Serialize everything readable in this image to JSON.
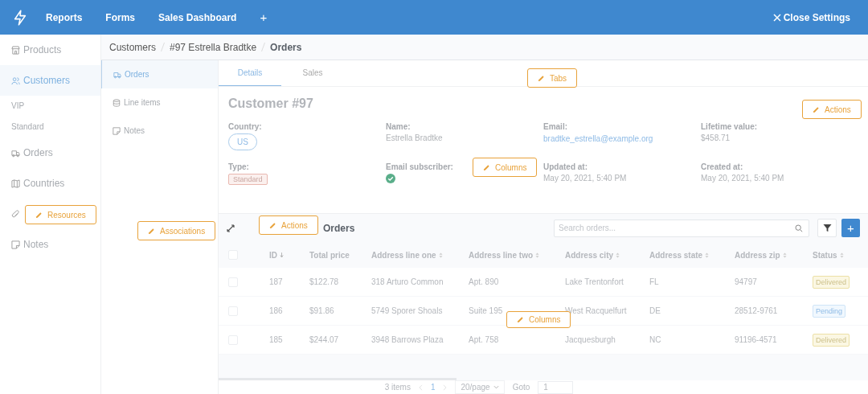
{
  "topbar": {
    "items": [
      "Reports",
      "Forms",
      "Sales Dashboard"
    ],
    "add": "+",
    "close": "Close Settings"
  },
  "sidebar": {
    "items": [
      {
        "label": "Products",
        "kind": "store",
        "selected": false
      },
      {
        "label": "Customers",
        "kind": "users",
        "selected": true,
        "children": [
          {
            "label": "VIP"
          },
          {
            "label": "Standard"
          }
        ]
      },
      {
        "label": "Orders",
        "kind": "truck",
        "selected": false
      },
      {
        "label": "Countries",
        "kind": "map",
        "selected": false
      },
      {
        "kind": "paperclip",
        "selected": false
      },
      {
        "label": "Notes",
        "kind": "note",
        "selected": false
      }
    ]
  },
  "breadcrumb": [
    "Customers",
    "#97 Estrella Bradtke",
    "Orders"
  ],
  "associations": [
    {
      "label": "Orders",
      "kind": "truck",
      "selected": true
    },
    {
      "label": "Line items",
      "kind": "db",
      "selected": false
    },
    {
      "label": "Notes",
      "kind": "note",
      "selected": false
    }
  ],
  "tabs": [
    {
      "label": "Details",
      "selected": true
    },
    {
      "label": "Sales",
      "selected": false
    }
  ],
  "customer": {
    "title": "Customer #97",
    "fields": [
      {
        "label": "Country:",
        "value": "US",
        "kind": "pill"
      },
      {
        "label": "Name:",
        "value": "Estrella Bradtke",
        "kind": "text"
      },
      {
        "label": "Email:",
        "value": "bradtke_estrella@example.org",
        "kind": "link"
      },
      {
        "label": "Lifetime value:",
        "value": "$458.71",
        "kind": "text"
      },
      {
        "label": "Type:",
        "value": "Standard",
        "kind": "tag"
      },
      {
        "label": "Email subscriber:",
        "kind": "check",
        "checked": true
      },
      {
        "label": "Updated at:",
        "value": "May 20, 2021, 5:40 PM",
        "kind": "text"
      },
      {
        "label": "Created at:",
        "value": "May 20, 2021, 5:40 PM",
        "kind": "text"
      }
    ]
  },
  "orders": {
    "title": "Orders",
    "search": {
      "placeholder": "Search orders..."
    },
    "add": "+",
    "all_checked": false,
    "columns": [
      {
        "label": "ID",
        "kind": "desc"
      },
      {
        "label": "Total price",
        "kind": "plain"
      },
      {
        "label": "Address line one",
        "kind": "sortable"
      },
      {
        "label": "Address line two",
        "kind": "sortable"
      },
      {
        "label": "Address city",
        "kind": "sortable"
      },
      {
        "label": "Address state",
        "kind": "sortable"
      },
      {
        "label": "Address zip",
        "kind": "sortable"
      },
      {
        "label": "Status",
        "kind": "sortable"
      }
    ],
    "rows": [
      {
        "checked": false,
        "cells": [
          "187",
          "$122.78",
          "318 Arturo Common",
          "Apt. 890",
          "Lake Trentonfort",
          "FL",
          "94797"
        ],
        "status": {
          "text": "Delivered",
          "kind": "delivered"
        }
      },
      {
        "checked": false,
        "cells": [
          "186",
          "$91.86",
          "5749 Sporer Shoals",
          "Suite 195",
          "West Racquelfurt",
          "DE",
          "28512-9761"
        ],
        "status": {
          "text": "Pending",
          "kind": "pending"
        }
      },
      {
        "checked": false,
        "cells": [
          "185",
          "$244.07",
          "3948 Barrows Plaza",
          "Apt. 758",
          "Jacquesburgh",
          "NC",
          "91196-4571"
        ],
        "status": {
          "text": "Delivered",
          "kind": "delivered"
        }
      }
    ],
    "pagination": {
      "count": "3 items",
      "page": "1",
      "per_page": "20/page",
      "goto": "Goto",
      "goto_value": "1"
    }
  },
  "edit_buttons": [
    {
      "label": "Tabs",
      "kind": "tabs"
    },
    {
      "label": "Actions",
      "kind": "customer-actions"
    },
    {
      "label": "Columns",
      "kind": "fields"
    },
    {
      "label": "Resources",
      "kind": "sidebar"
    },
    {
      "label": "Associations",
      "kind": "associations"
    },
    {
      "label": "Actions",
      "kind": "orders-actions"
    },
    {
      "label": "Columns",
      "kind": "table"
    }
  ]
}
